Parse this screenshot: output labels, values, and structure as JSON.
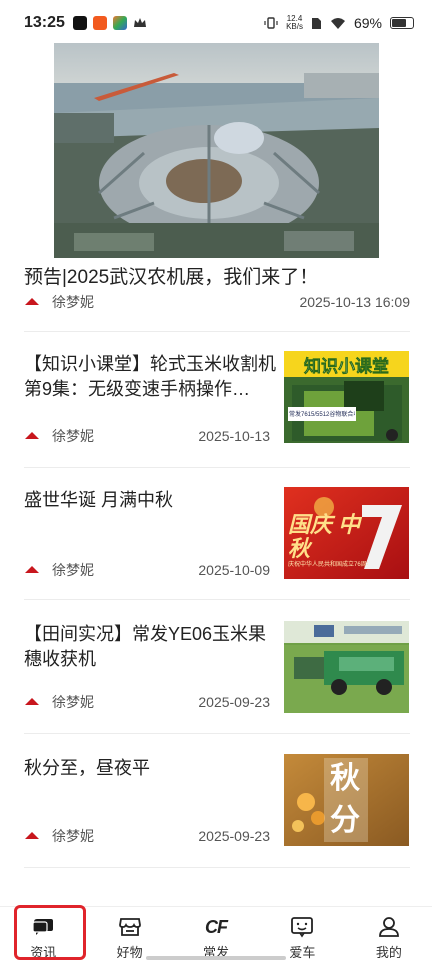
{
  "status_bar": {
    "time": "13:25",
    "speed_value": "12.4",
    "speed_unit": "KB/s",
    "battery": "69%",
    "icons": [
      "douyin-icon",
      "app-icon-orange",
      "app-icon-multicolor",
      "crown-icon",
      "vibrate-icon",
      "wifi-icon",
      "battery-icon"
    ]
  },
  "hero": {
    "title": "预告|2025武汉农机展，我们来了！",
    "author": "徐梦妮",
    "date": "2025-10-13 16:09"
  },
  "articles": [
    {
      "title": "【知识小课堂】轮式玉米收割机第9集：无级变速手柄操作…",
      "author": "徐梦妮",
      "date": "2025-10-13",
      "thumb_heading": "知识小课堂",
      "thumb_caption": "常发7615/5512谷物联合收割机"
    },
    {
      "title": "盛世华诞 月满中秋",
      "author": "徐梦妮",
      "date": "2025-10-09",
      "thumb_heading": "国庆 中秋",
      "thumb_caption": "庆祝中华人民共和国成立76周年"
    },
    {
      "title": "【田间实况】常发YE06玉米果穗收获机",
      "author": "徐梦妮",
      "date": "2025-09-23"
    },
    {
      "title": "秋分至，昼夜平",
      "author": "徐梦妮",
      "date": "2025-09-23",
      "thumb_heading": "秋 分"
    }
  ],
  "bottom_nav": [
    {
      "label": "资讯",
      "icon": "chat-bubble-icon",
      "active": true
    },
    {
      "label": "好物",
      "icon": "store-icon"
    },
    {
      "label": "常发",
      "icon_text": "CF"
    },
    {
      "label": "爱车",
      "icon": "smile-card-icon"
    },
    {
      "label": "我的",
      "icon": "person-icon"
    }
  ],
  "colors": {
    "highlight": "#e0242b",
    "brand_red": "#c8161d"
  }
}
